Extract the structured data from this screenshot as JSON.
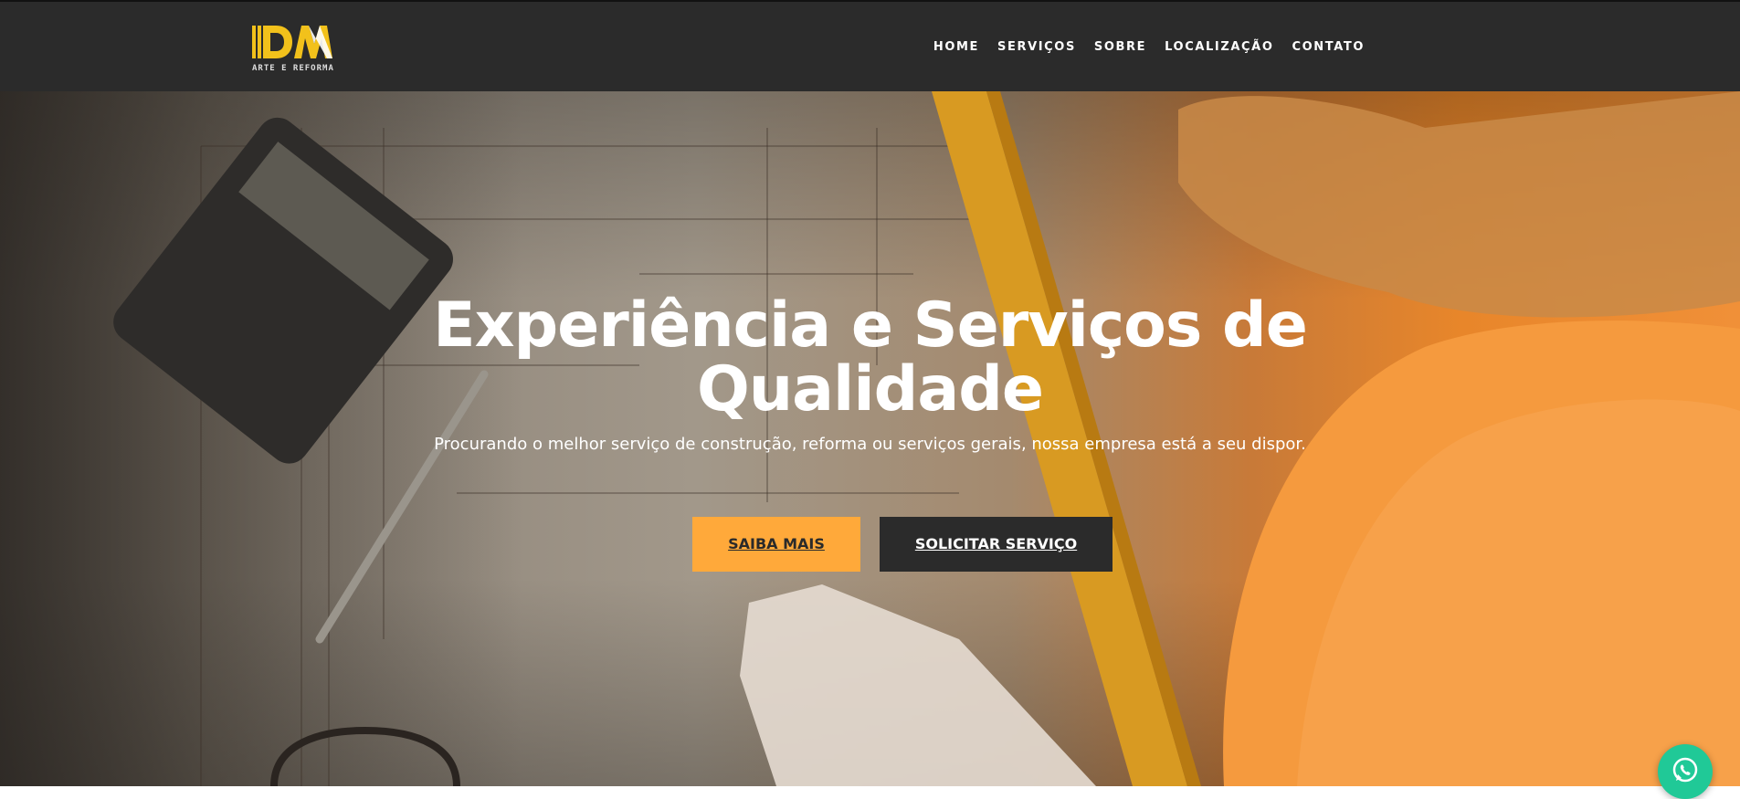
{
  "brand": {
    "logo_text": "DM",
    "tagline": "ARTE E REFORMA"
  },
  "nav": [
    {
      "label": "HOME"
    },
    {
      "label": "SERVIÇOS"
    },
    {
      "label": "SOBRE"
    },
    {
      "label": "LOCALIZAÇÃO"
    },
    {
      "label": "CONTATO"
    }
  ],
  "hero": {
    "title": "Experiência e Serviços de Qualidade",
    "subtitle": "Procurando o melhor serviço de construção, reforma ou serviços gerais, nossa empresa está a seu dispor.",
    "primary_button": "SAIBA MAIS",
    "secondary_button": "SOLICITAR SERVIÇO"
  },
  "colors": {
    "navbar": "#2b2b2b",
    "accent": "#ffa93a",
    "logo_yellow": "#f2c11b",
    "whatsapp": "#20c997"
  },
  "icons": {
    "floating": "whatsapp-icon"
  }
}
